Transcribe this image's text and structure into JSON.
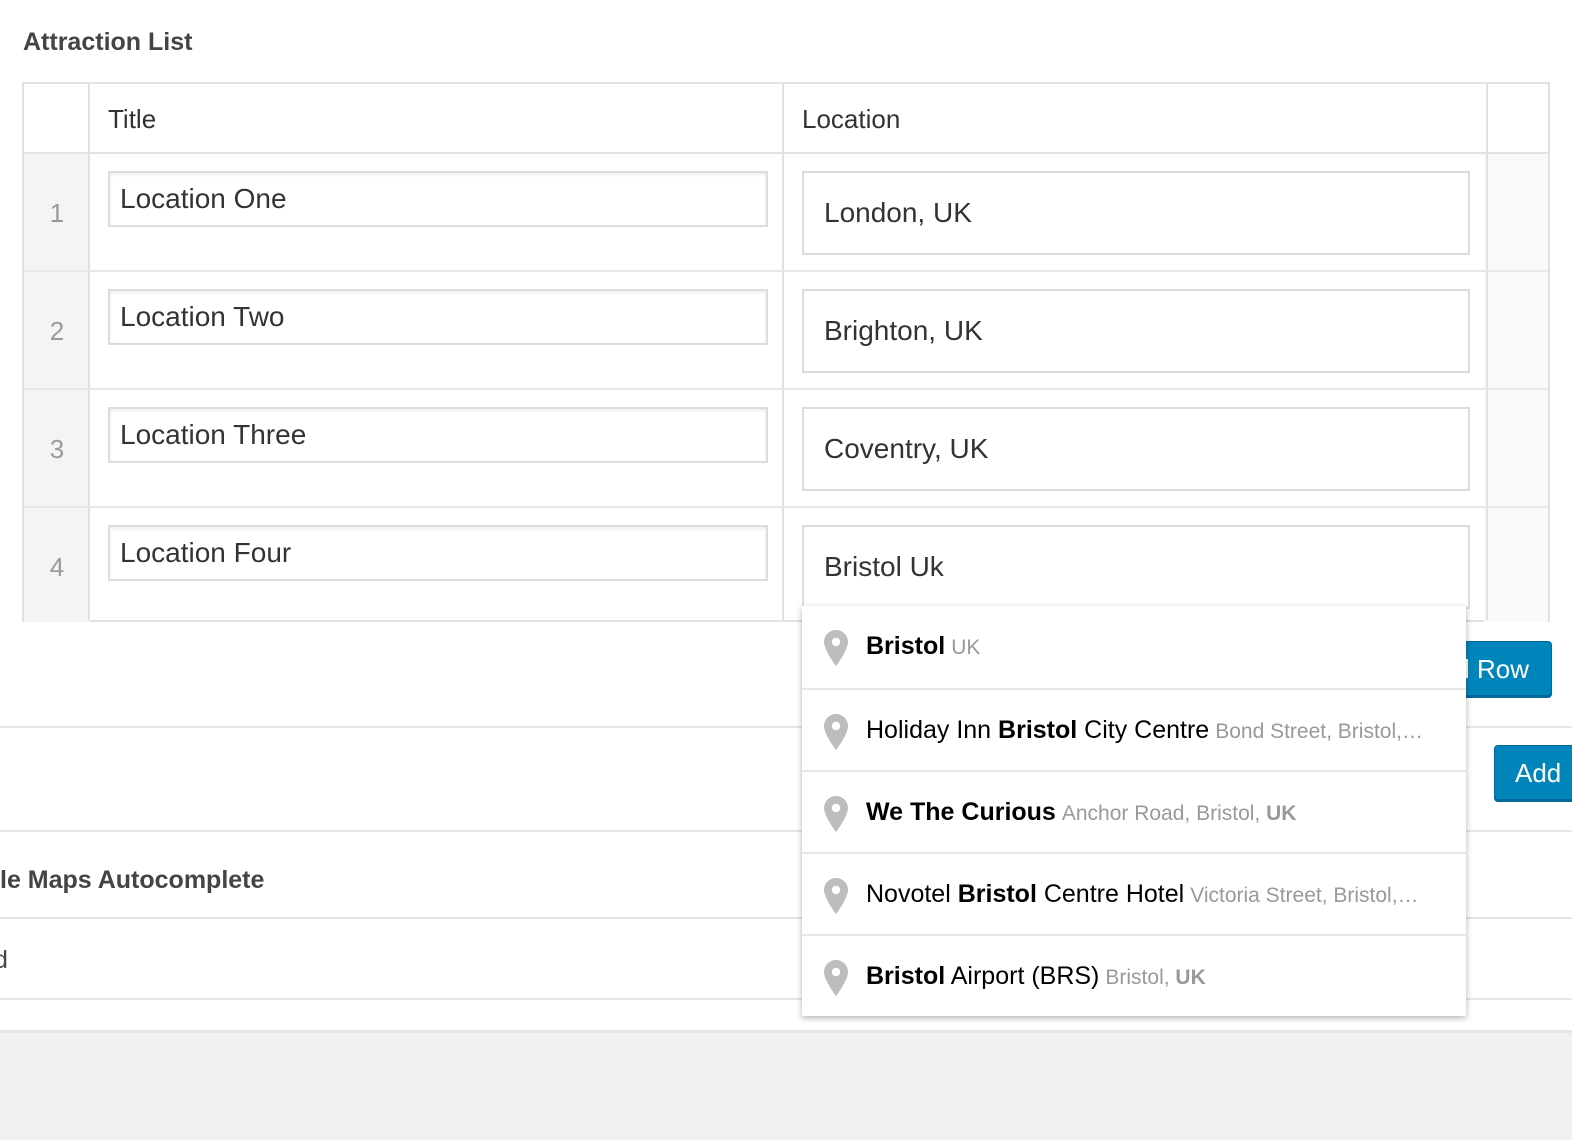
{
  "section": {
    "title": "Attraction List"
  },
  "table": {
    "headers": {
      "title": "Title",
      "location": "Location"
    },
    "rows": [
      {
        "num": "1",
        "title": "Location One",
        "location": "London, UK"
      },
      {
        "num": "2",
        "title": "Location Two",
        "location": "Brighton, UK"
      },
      {
        "num": "3",
        "title": "Location Three",
        "location": "Coventry, UK"
      },
      {
        "num": "4",
        "title": "Location Four",
        "location": "Bristol Uk"
      }
    ]
  },
  "buttons": {
    "add_row": "Add Row",
    "add": "Add"
  },
  "background_rows": {
    "heading_fragment": "le Maps Autocomplete",
    "text_fragment": "d"
  },
  "autocomplete": {
    "icon": "map-pin-icon",
    "suggestions": [
      {
        "pre": "",
        "match": "Bristol",
        "post": "",
        "secondary": "UK",
        "secondary_match": "UK"
      },
      {
        "pre": "Holiday Inn ",
        "match": "Bristol",
        "post": " City Centre",
        "secondary": "Bond Street, Bristol,…",
        "secondary_match": ""
      },
      {
        "pre": "",
        "match": "We The Curious",
        "post": "",
        "secondary": "Anchor Road, Bristol, ",
        "secondary_match": "UK"
      },
      {
        "pre": "Novotel ",
        "match": "Bristol",
        "post": " Centre Hotel",
        "secondary": "Victoria Street, Bristol,…",
        "secondary_match": ""
      },
      {
        "pre": "",
        "match": "Bristol",
        "post": " Airport (BRS)",
        "secondary": "Bristol, ",
        "secondary_match": "UK"
      }
    ]
  },
  "colors": {
    "button_blue": "#0085ba",
    "border": "#e1e1e1",
    "background": "#f1f1f1"
  }
}
